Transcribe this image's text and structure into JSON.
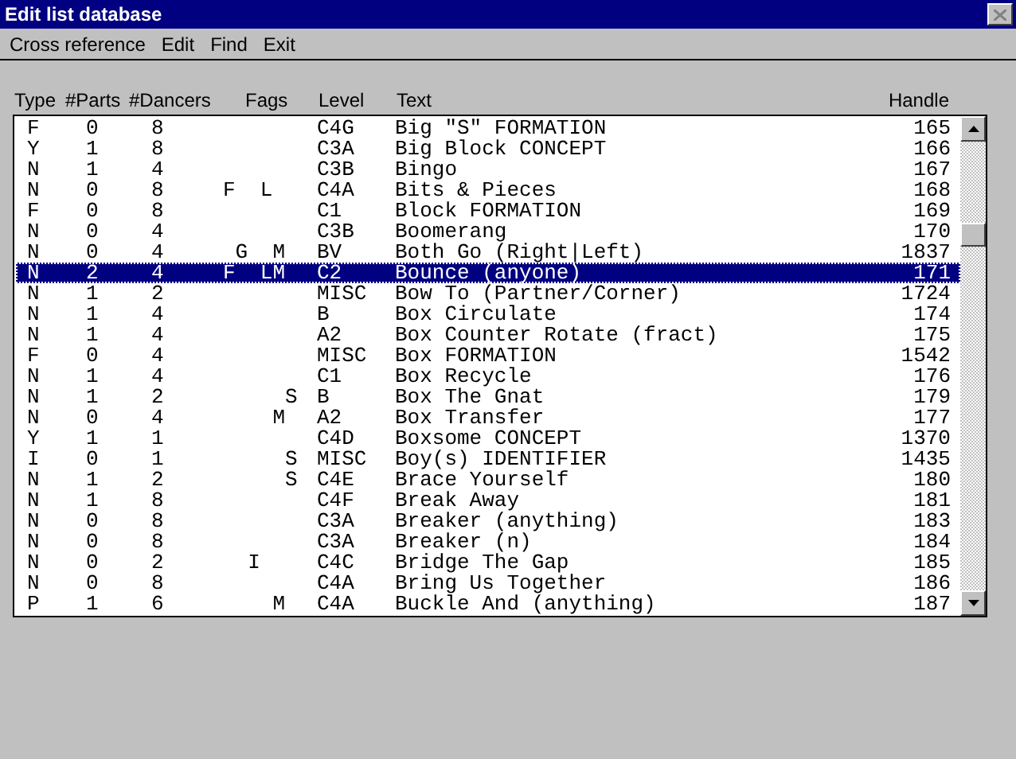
{
  "window": {
    "title": "Edit list database"
  },
  "menu": [
    "Cross reference",
    "Edit",
    "Find",
    "Exit"
  ],
  "columns": [
    "Type",
    "#Parts",
    "#Dancers",
    "Fags",
    "Level",
    "Text",
    "Handle"
  ],
  "rows": [
    {
      "type": "F",
      "parts": "0",
      "dancers": "8",
      "flags": "",
      "level": "C4G",
      "text": "Big \"S\" FORMATION",
      "handle": "165",
      "selected": false
    },
    {
      "type": "Y",
      "parts": "1",
      "dancers": "8",
      "flags": "",
      "level": "C3A",
      "text": "Big Block CONCEPT",
      "handle": "166",
      "selected": false
    },
    {
      "type": "N",
      "parts": "1",
      "dancers": "4",
      "flags": "",
      "level": "C3B",
      "text": "Bingo",
      "handle": "167",
      "selected": false
    },
    {
      "type": "N",
      "parts": "0",
      "dancers": "8",
      "flags": "F  L",
      "level": "C4A",
      "text": "Bits & Pieces",
      "handle": "168",
      "selected": false
    },
    {
      "type": "F",
      "parts": "0",
      "dancers": "8",
      "flags": "",
      "level": "C1",
      "text": "Block FORMATION",
      "handle": "169",
      "selected": false
    },
    {
      "type": "N",
      "parts": "0",
      "dancers": "4",
      "flags": "",
      "level": "C3B",
      "text": "Boomerang",
      "handle": "170",
      "selected": false
    },
    {
      "type": "N",
      "parts": "0",
      "dancers": "4",
      "flags": " G  M",
      "level": "BV",
      "text": "Both Go (Right|Left)",
      "handle": "1837",
      "selected": false
    },
    {
      "type": "N",
      "parts": "2",
      "dancers": "4",
      "flags": "F  LM",
      "level": "C2",
      "text": "Bounce (anyone)",
      "handle": "171",
      "selected": true
    },
    {
      "type": "N",
      "parts": "1",
      "dancers": "2",
      "flags": "",
      "level": "MISC",
      "text": "Bow To (Partner/Corner)",
      "handle": "1724",
      "selected": false
    },
    {
      "type": "N",
      "parts": "1",
      "dancers": "4",
      "flags": "",
      "level": "B",
      "text": "Box Circulate",
      "handle": "174",
      "selected": false
    },
    {
      "type": "N",
      "parts": "1",
      "dancers": "4",
      "flags": "",
      "level": "A2",
      "text": "Box Counter Rotate (fract)",
      "handle": "175",
      "selected": false
    },
    {
      "type": "F",
      "parts": "0",
      "dancers": "4",
      "flags": "",
      "level": "MISC",
      "text": "Box FORMATION",
      "handle": "1542",
      "selected": false
    },
    {
      "type": "N",
      "parts": "1",
      "dancers": "4",
      "flags": "",
      "level": "C1",
      "text": "Box Recycle",
      "handle": "176",
      "selected": false
    },
    {
      "type": "N",
      "parts": "1",
      "dancers": "2",
      "flags": "     S",
      "level": "B",
      "text": "Box The Gnat",
      "handle": "179",
      "selected": false
    },
    {
      "type": "N",
      "parts": "0",
      "dancers": "4",
      "flags": "    M",
      "level": "A2",
      "text": "Box Transfer",
      "handle": "177",
      "selected": false
    },
    {
      "type": "Y",
      "parts": "1",
      "dancers": "1",
      "flags": "",
      "level": "C4D",
      "text": "Boxsome CONCEPT",
      "handle": "1370",
      "selected": false
    },
    {
      "type": "I",
      "parts": "0",
      "dancers": "1",
      "flags": "     S",
      "level": "MISC",
      "text": "Boy(s) IDENTIFIER",
      "handle": "1435",
      "selected": false
    },
    {
      "type": "N",
      "parts": "1",
      "dancers": "2",
      "flags": "     S",
      "level": "C4E",
      "text": "Brace Yourself",
      "handle": "180",
      "selected": false
    },
    {
      "type": "N",
      "parts": "1",
      "dancers": "8",
      "flags": "",
      "level": "C4F",
      "text": "Break Away",
      "handle": "181",
      "selected": false
    },
    {
      "type": "N",
      "parts": "0",
      "dancers": "8",
      "flags": "",
      "level": "C3A",
      "text": "Breaker (anything)",
      "handle": "183",
      "selected": false
    },
    {
      "type": "N",
      "parts": "0",
      "dancers": "8",
      "flags": "",
      "level": "C3A",
      "text": "Breaker (n)",
      "handle": "184",
      "selected": false
    },
    {
      "type": "N",
      "parts": "0",
      "dancers": "2",
      "flags": "  I",
      "level": "C4C",
      "text": "Bridge The Gap",
      "handle": "185",
      "selected": false
    },
    {
      "type": "N",
      "parts": "0",
      "dancers": "8",
      "flags": "",
      "level": "C4A",
      "text": "Bring Us Together",
      "handle": "186",
      "selected": false
    },
    {
      "type": "P",
      "parts": "1",
      "dancers": "6",
      "flags": "    M",
      "level": "C4A",
      "text": "Buckle And (anything)",
      "handle": "187",
      "selected": false
    }
  ]
}
